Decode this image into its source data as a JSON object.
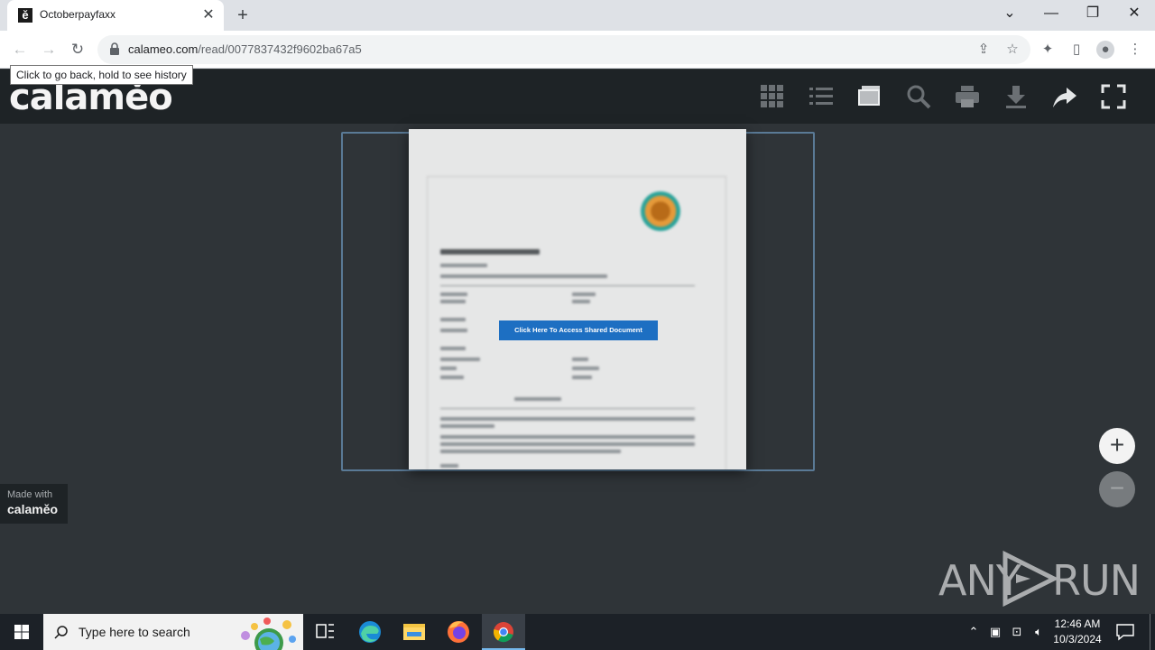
{
  "browser": {
    "tab_title": "Octoberpayfaxx",
    "tab_favicon": "ě",
    "url_host": "calameo.com",
    "url_path": "/read/0077837432f9602ba67a5",
    "tooltip": "Click to go back, hold to see history"
  },
  "calameo": {
    "logo": "calaměo",
    "toolbar_icons": [
      "grid-icon",
      "list-icon",
      "folder-icon",
      "search-icon",
      "print-icon",
      "download-icon",
      "share-icon",
      "fullscreen-icon"
    ],
    "document_button": "Click Here To Access Shared Document",
    "made_with_line1": "Made with",
    "made_with_line2": "calaměo",
    "zoom_in": "+",
    "zoom_out": "−"
  },
  "watermark": {
    "left": "ANY",
    "right": "RUN"
  },
  "taskbar": {
    "search_placeholder": "Type here to search",
    "time": "12:46 AM",
    "date": "10/3/2024",
    "apps": [
      "task-view-icon",
      "edge-icon",
      "file-explorer-icon",
      "firefox-icon",
      "chrome-icon"
    ]
  },
  "colors": {
    "accent_blue": "#1d6fc2",
    "header_bg": "#1e2326",
    "viewer_bg": "#2f3438"
  }
}
